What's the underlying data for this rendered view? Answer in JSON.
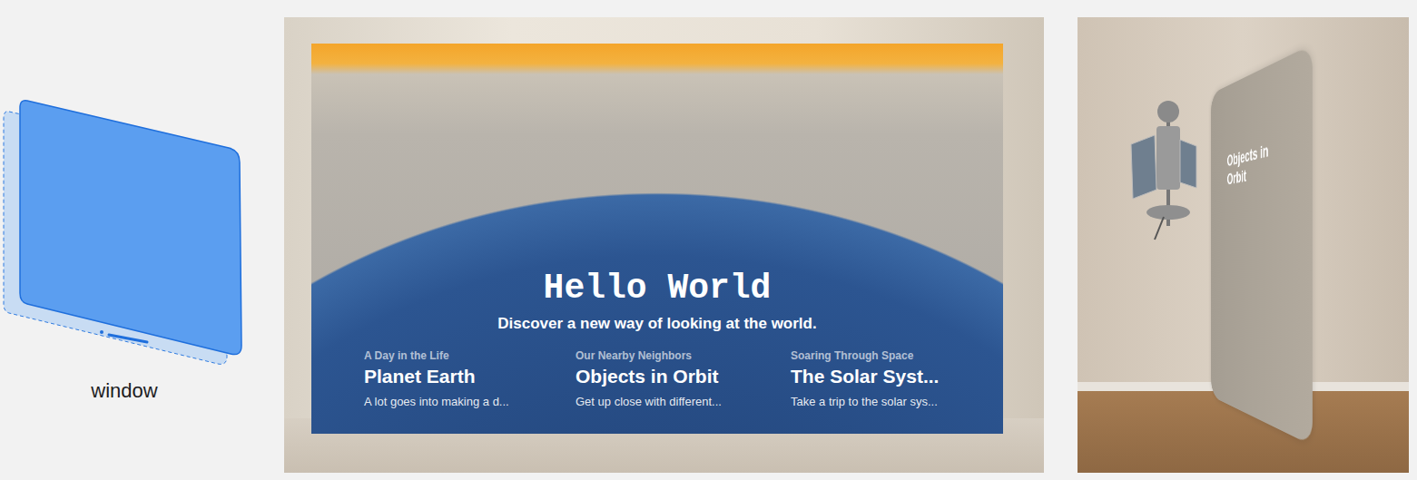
{
  "illustration": {
    "label": "window"
  },
  "app_window": {
    "title": "Hello World",
    "subtitle": "Discover a new way of looking at the world.",
    "cards": [
      {
        "eyebrow": "A Day in the Life",
        "title": "Planet Earth",
        "description": "A lot goes into making a d..."
      },
      {
        "eyebrow": "Our Nearby Neighbors",
        "title": "Objects in Orbit",
        "description": "Get up close with different..."
      },
      {
        "eyebrow": "Soaring Through Space",
        "title": "The Solar Syst...",
        "description": "Take a trip to the solar sys..."
      }
    ]
  },
  "side_view": {
    "title": "Objects in Orbit"
  }
}
